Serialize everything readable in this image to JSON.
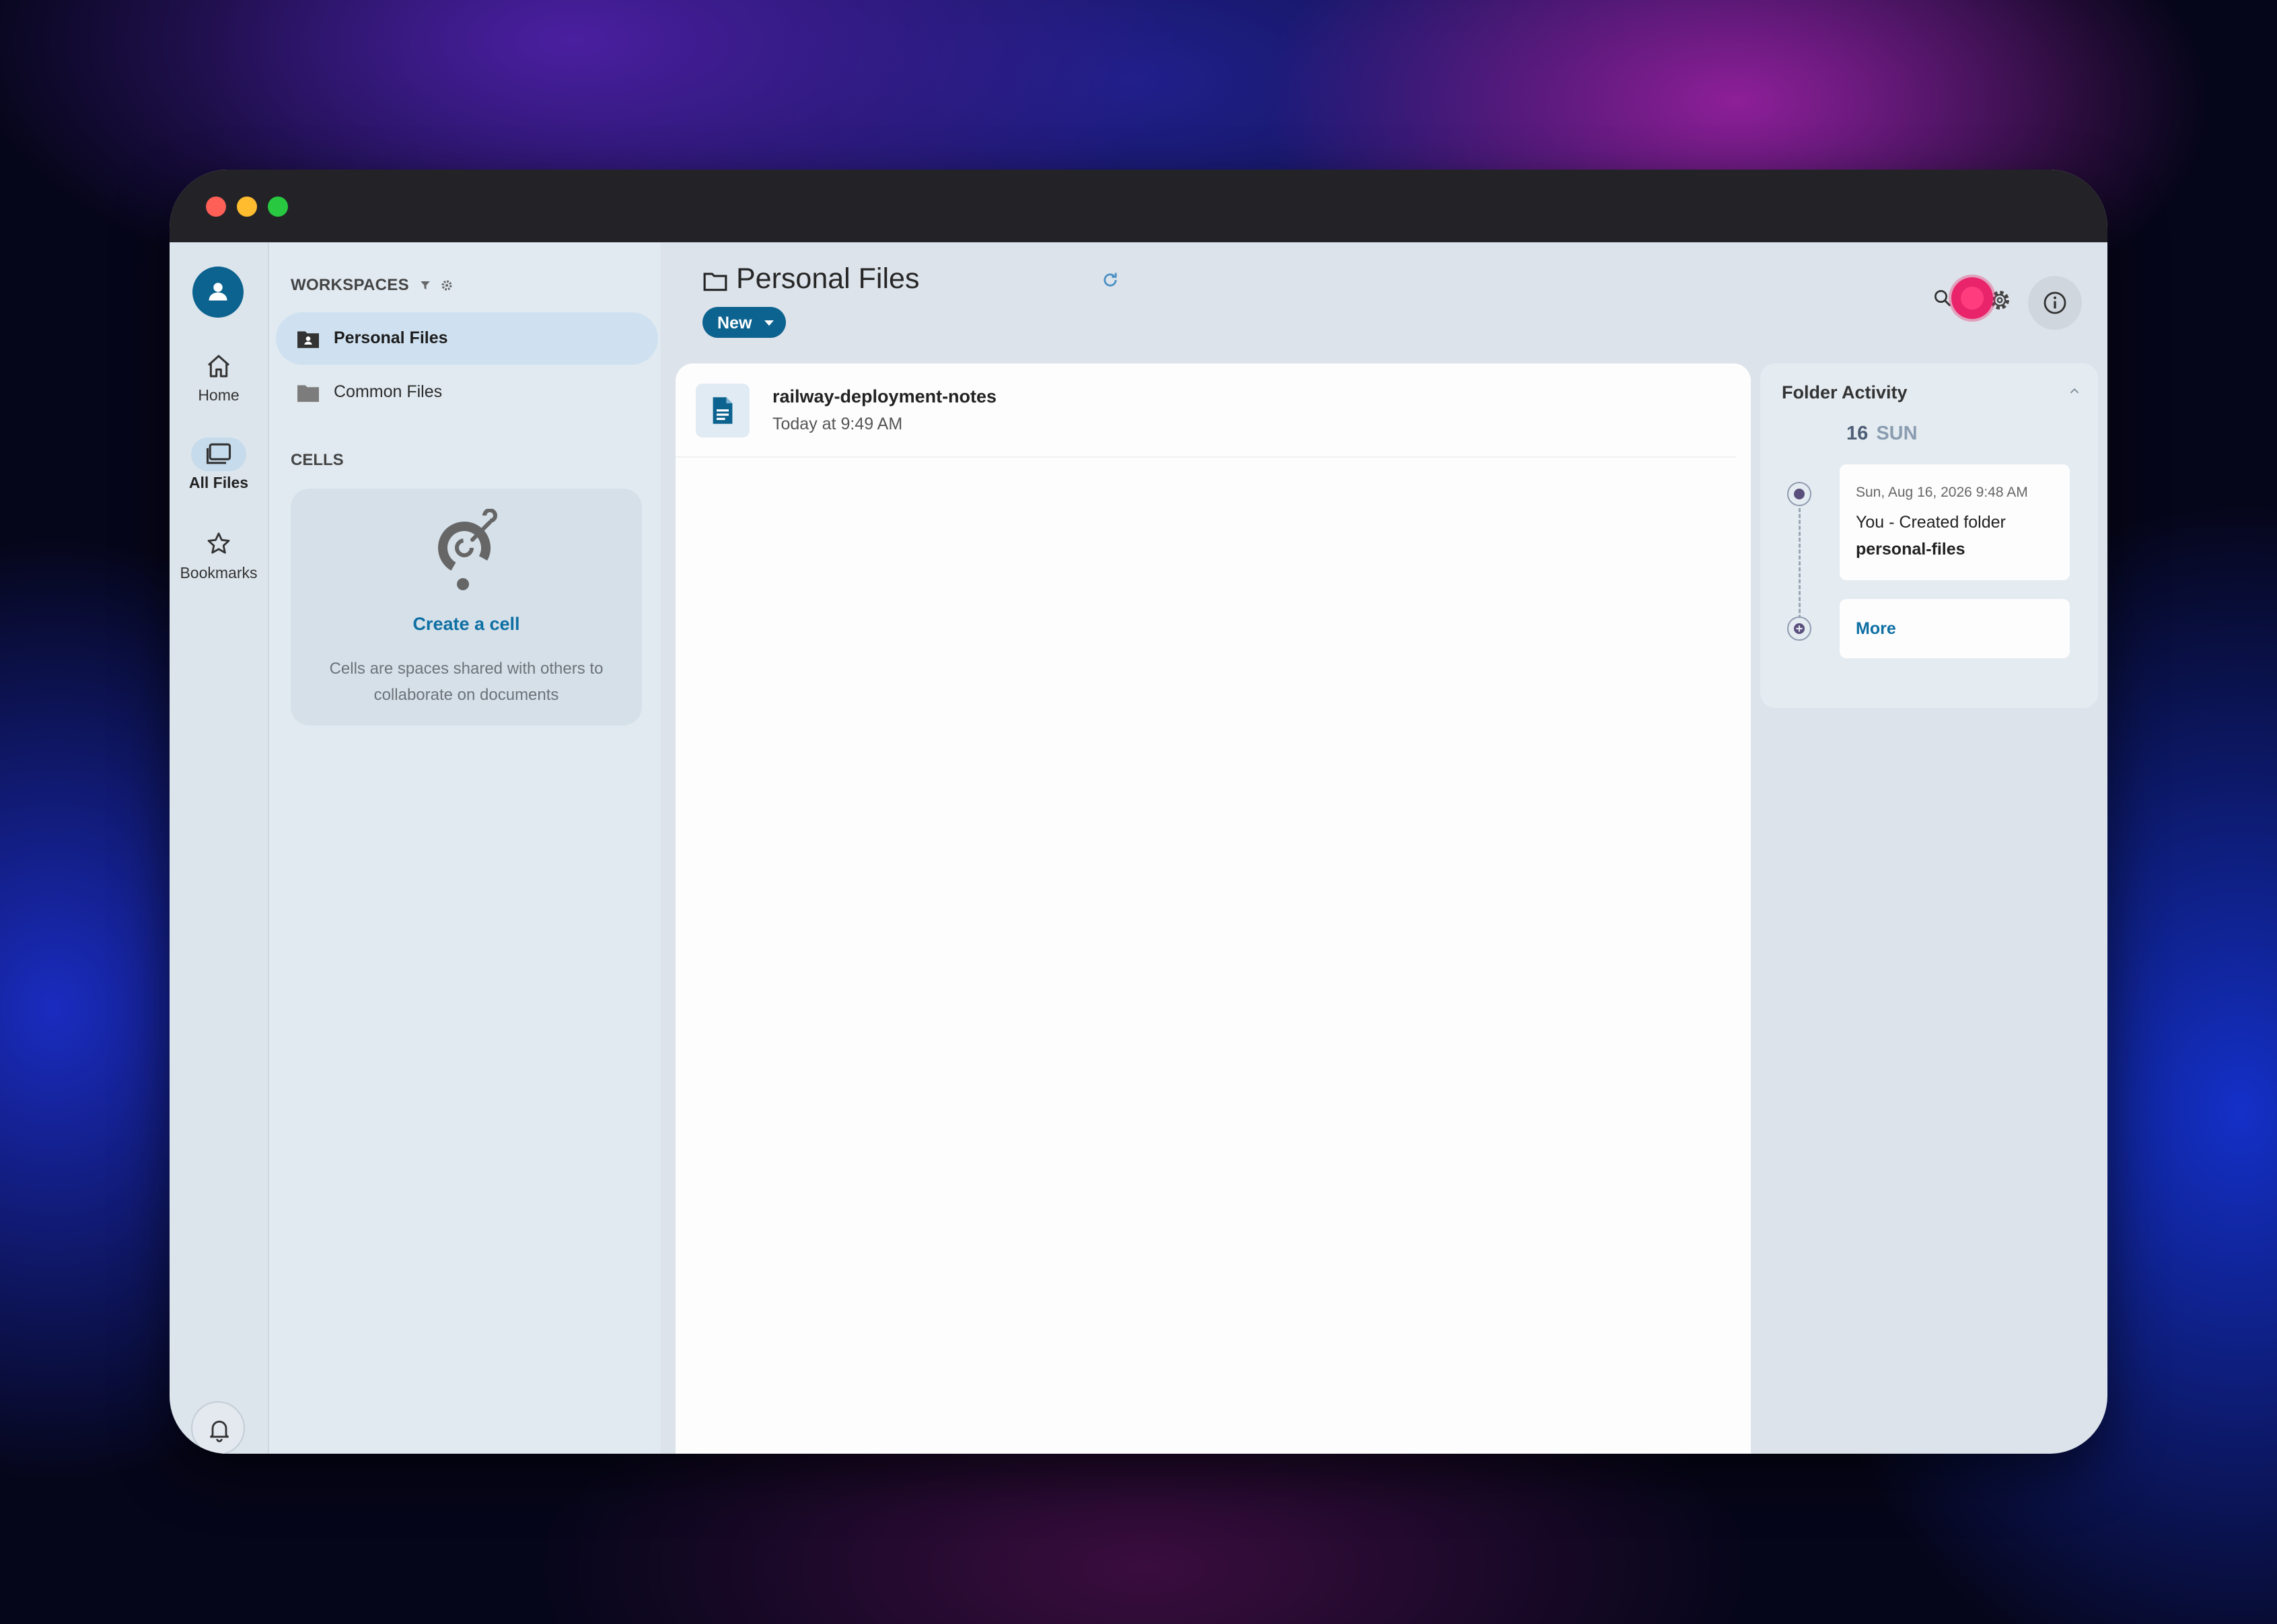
{
  "sidebar": {
    "items": [
      {
        "label": "Home",
        "icon": "home-icon"
      },
      {
        "label": "All Files",
        "icon": "folders-icon"
      },
      {
        "label": "Bookmarks",
        "icon": "star-icon"
      }
    ],
    "bottom_icons": [
      "bell-icon",
      "contact-card-icon",
      "magic-wand-icon"
    ]
  },
  "workspaces": {
    "heading": "WORKSPACES",
    "items": [
      {
        "label": "Personal Files",
        "icon": "personal-folder-icon",
        "active": true
      },
      {
        "label": "Common Files",
        "icon": "folder-icon",
        "active": false
      }
    ]
  },
  "cells": {
    "heading": "CELLS",
    "create_label": "Create a cell",
    "description": "Cells are spaces shared with others to collaborate on documents"
  },
  "header": {
    "title": "Personal Files",
    "new_label": "New"
  },
  "files": [
    {
      "name": "railway-deployment-notes",
      "date": "Today at 9:49 AM",
      "icon": "document-icon"
    }
  ],
  "activity": {
    "title": "Folder Activity",
    "day_number": "16",
    "day_name": "SUN",
    "entry": {
      "date": "Sun, Aug 16, 2026 9:48 AM",
      "text": "You - Created folder",
      "target": "personal-files"
    },
    "more_label": "More"
  },
  "colors": {
    "accent": "#0c6390",
    "link": "#0e6fa3",
    "recording": "#e9246a"
  }
}
